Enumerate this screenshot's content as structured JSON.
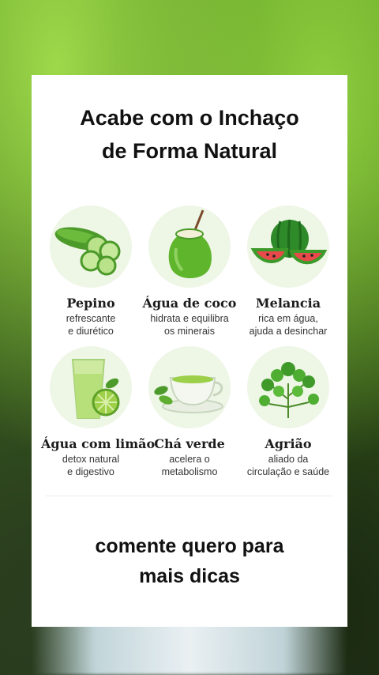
{
  "card": {
    "title_line1": "Acabe com o Inchaço",
    "title_line2": "de Forma Natural",
    "items": [
      {
        "name": "Pepino",
        "desc": "refrescante\ne diurético",
        "icon": "cucumber-icon"
      },
      {
        "name": "Água de coco",
        "desc": "hidrata e equilibra\nos minerais",
        "icon": "coconut-icon"
      },
      {
        "name": "Melancia",
        "desc": "rica em água,\najuda a desinchar",
        "icon": "watermelon-icon"
      },
      {
        "name": "Água com limão",
        "desc": "detox natural\ne digestivo",
        "icon": "lemon-water-icon"
      },
      {
        "name": "Chá verde",
        "desc": "acelera o\nmetabolismo",
        "icon": "green-tea-icon"
      },
      {
        "name": "Agrião",
        "desc": "aliado da\ncirculação e saúde",
        "icon": "watercress-icon"
      }
    ],
    "cta": "comente quero para\nmais dicas"
  },
  "colors": {
    "background_green": "#6fae2c",
    "card_bg": "#ffffff",
    "icon_circle": "#eef6e6"
  }
}
